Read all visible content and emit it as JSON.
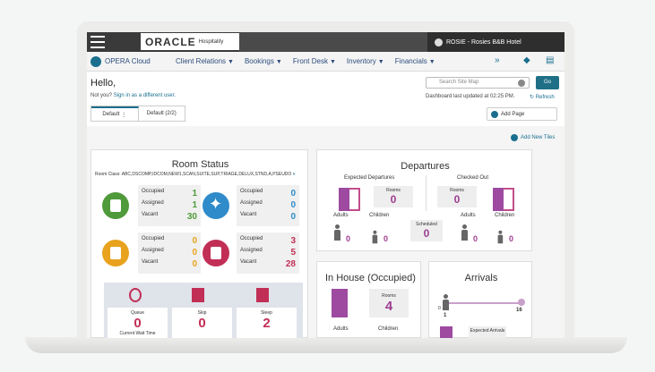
{
  "topbar": {
    "logo": "ORACLE",
    "logo_sub": "Hospitality",
    "user": "ROSIE - Rosies B&B Hotel"
  },
  "nav": {
    "brand": "OPERA Cloud",
    "items": [
      "Client Relations",
      "Bookings",
      "Front Desk",
      "Inventory",
      "Financials"
    ]
  },
  "hello": {
    "greeting": "Hello,",
    "notyou": "Not you?",
    "signin": "Sign in as a different user."
  },
  "search": {
    "placeholder": "Search Site Map",
    "go": "Go"
  },
  "dashboard": {
    "updated": "Dashboard last updated at 02:25 PM.",
    "refresh": "Refresh",
    "add_page": "Add Page",
    "add_tiles": "Add New Tiles"
  },
  "tabs": [
    "Default",
    "Default (2/2)"
  ],
  "room_status": {
    "title": "Room Status",
    "room_class": "Room Class: ABC,DSCOMP,IDCOM,NEW1,SCAN,SUITE,SUP,TRIAGE,DELUX,STND,A,PSEUDO",
    "labels": [
      "Occupied",
      "Assigned",
      "Vacant"
    ],
    "groups": [
      {
        "values": [
          "1",
          "1",
          "30"
        ],
        "color": "#4f9a3a"
      },
      {
        "values": [
          "0",
          "0",
          "0"
        ],
        "color": "#2f8bc9"
      },
      {
        "values": [
          "0",
          "0",
          "0"
        ],
        "color": "#e8a21f"
      },
      {
        "values": [
          "3",
          "5",
          "28"
        ],
        "color": "#c22f56"
      }
    ],
    "bottom": [
      {
        "label": "Queue",
        "value": "0",
        "sub": "Current Wait Time"
      },
      {
        "label": "Skip",
        "value": "0",
        "sub": ""
      },
      {
        "label": "Sleep",
        "value": "2",
        "sub": ""
      }
    ]
  },
  "departures": {
    "title": "Departures",
    "expected": "Expected Departures",
    "checked_out": "Checked Out",
    "rooms_label": "Rooms",
    "rooms_expected": "0",
    "rooms_checked": "0",
    "adults": "Adults",
    "children": "Children",
    "scheduled": "Scheduled",
    "adults_exp": "0",
    "children_exp": "0",
    "scheduled_val": "0",
    "adults_out": "0",
    "children_out": "0"
  },
  "in_house": {
    "title": "In House (Occupied)",
    "rooms_label": "Rooms",
    "rooms": "4",
    "adults": "Adults",
    "children": "Children"
  },
  "arrivals": {
    "title": "Arrivals",
    "min": "0",
    "max": "16",
    "current": "1",
    "expected": "Expected Arrivals"
  }
}
